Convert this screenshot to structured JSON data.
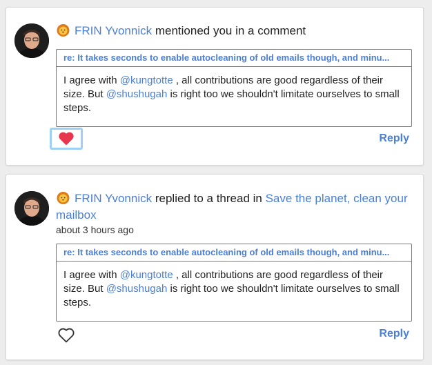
{
  "notifications": [
    {
      "author": "FRIN Yvonnick",
      "action": "mentioned you in a comment",
      "thread_title": "",
      "time": "",
      "quote": {
        "title": "re: It takes seconds to enable autocleaning of old emails though, and minu...",
        "text_1": "I agree with ",
        "mention_1": "@kungtotte",
        "text_2": " , all contributions are good regardless of their size. But ",
        "mention_2": "@shushugah",
        "text_3": " is right too we shouldn't limitate ourselves to small steps."
      },
      "liked": true,
      "like_icon": "heart-filled-icon",
      "reply_label": "Reply"
    },
    {
      "author": "FRIN Yvonnick",
      "action": "replied to a thread in",
      "thread_title": "Save the planet, clean your mailbox",
      "time": "about 3 hours ago",
      "quote": {
        "title": "re: It takes seconds to enable autocleaning of old emails though, and minu...",
        "text_1": "I agree with ",
        "mention_1": "@kungtotte",
        "text_2": " , all contributions are good regardless of their size. But ",
        "mention_2": "@shushugah",
        "text_3": " is right too we shouldn't limitate ourselves to small steps."
      },
      "liked": false,
      "like_icon": "heart-outline-icon",
      "reply_label": "Reply"
    }
  ],
  "colors": {
    "link": "#4a7fd7",
    "heart_filled": "#e8364f",
    "like_focus_ring": "#9cd0f5",
    "background": "#ededed"
  }
}
